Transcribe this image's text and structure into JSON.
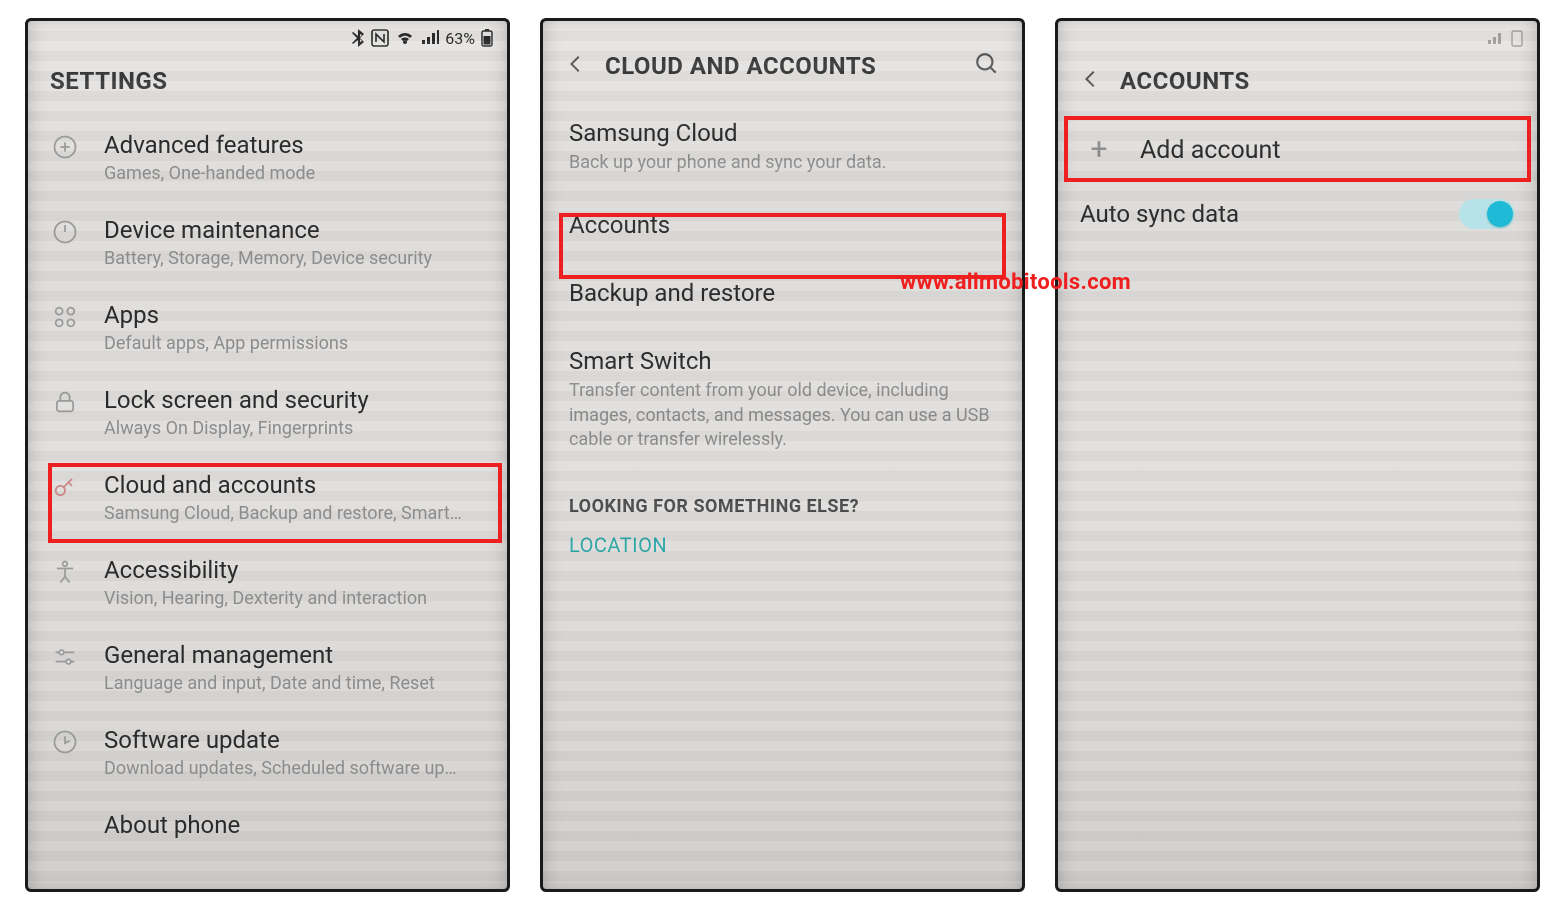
{
  "watermark": "www.allmobitools.com",
  "statusbar": {
    "battery": "63%"
  },
  "screen1": {
    "title": "SETTINGS",
    "items": [
      {
        "title": "Advanced features",
        "sub": "Games, One-handed mode"
      },
      {
        "title": "Device maintenance",
        "sub": "Battery, Storage, Memory, Device security"
      },
      {
        "title": "Apps",
        "sub": "Default apps, App permissions"
      },
      {
        "title": "Lock screen and security",
        "sub": "Always On Display, Fingerprints"
      },
      {
        "title": "Cloud and accounts",
        "sub": "Samsung Cloud, Backup and restore, Smart…"
      },
      {
        "title": "Accessibility",
        "sub": "Vision, Hearing, Dexterity and interaction"
      },
      {
        "title": "General management",
        "sub": "Language and input, Date and time, Reset"
      },
      {
        "title": "Software update",
        "sub": "Download updates, Scheduled software up…"
      },
      {
        "title": "About phone",
        "sub": ""
      }
    ]
  },
  "screen2": {
    "title": "CLOUD AND ACCOUNTS",
    "sections": [
      {
        "title": "Samsung Cloud",
        "sub": "Back up your phone and sync your data."
      },
      {
        "title": "Accounts",
        "sub": ""
      },
      {
        "title": "Backup and restore",
        "sub": ""
      },
      {
        "title": "Smart Switch",
        "sub": "Transfer content from your old device, including images, contacts, and messages. You can use a USB cable or transfer wirelessly."
      }
    ],
    "looking_label": "LOOKING FOR SOMETHING ELSE?",
    "location_link": "LOCATION"
  },
  "screen3": {
    "title": "ACCOUNTS",
    "add_label": "Add account",
    "autosync_label": "Auto sync data"
  }
}
